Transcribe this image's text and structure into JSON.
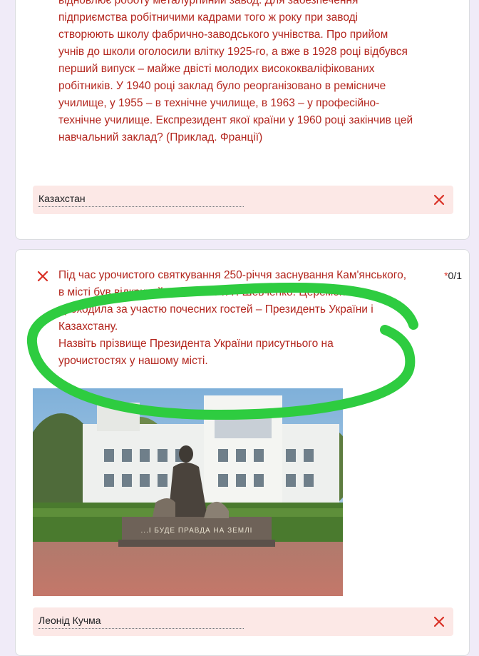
{
  "question1": {
    "text": "відновлює роботу металургійний завод. Для забезпечення\nпідприємства робітничими кадрами того ж року при заводі\nстворюють школу фабрично-заводського учнівства. Про прийом\nучнів до школи оголосили влітку 1925-го, а вже в 1928 році відбувся\nперший випуск – майже двісті молодих висококваліфікованих\nробітників. У 1940 році заклад було реорганізовано в ремісниче\nучилище, у 1955 – в технічне училище, в 1963 – у професійно-\nтехнічне училище. Експрезидент якої країни у 1960 році закінчив цей\nнавчальний заклад?  (Приклад. Франції)",
    "answer": "Казахстан"
  },
  "question2": {
    "text": "Під час урочистого святкування 250-річчя заснування Кам'янського,\nв місті був відкритий пам'ятник Т. Г. Шевченко. Церемонія\nпроходила за участю почесних гостей – Президенть України і\n Казахстану.\n         Назвіть прізвище  Президента  України присутнього на\nурочистостях у нашому місті.",
    "required_mark": "*",
    "points": "0/1",
    "photo_inscription": "...І БУДЕ ПРАВДА НА ЗЕМЛІ",
    "answer": "Леонід Кучма"
  },
  "colors": {
    "background": "#f0ebf8",
    "question_text": "#b3261e",
    "incorrect_answer_bg": "#fce8e6",
    "incorrect_icon": "#d93025",
    "annotation": "#2ecc40"
  }
}
